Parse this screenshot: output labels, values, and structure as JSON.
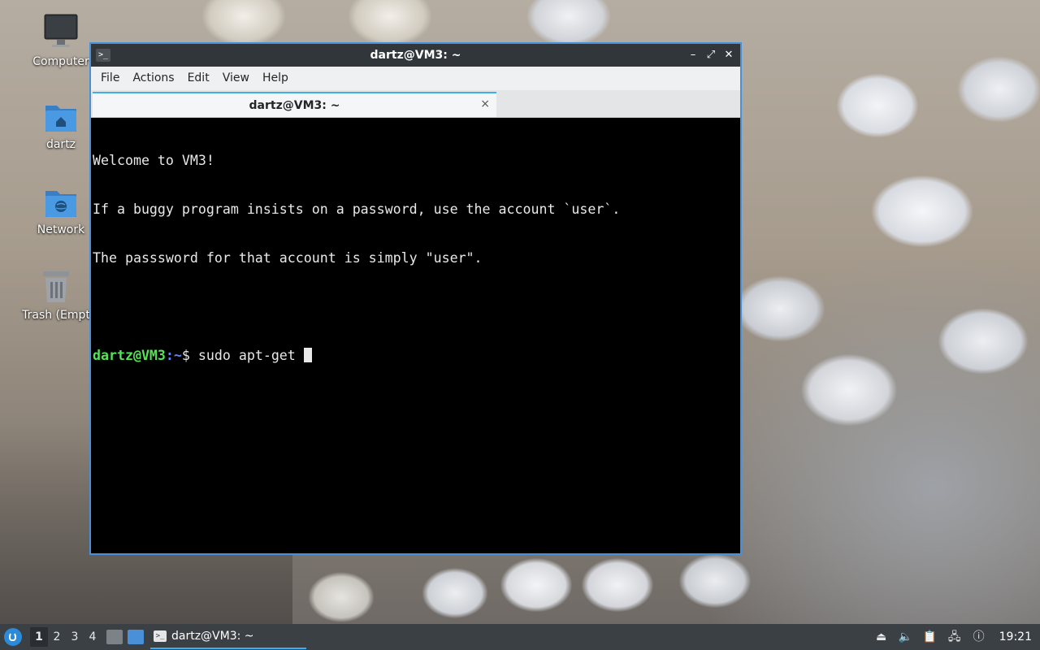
{
  "desktop": {
    "icons": [
      {
        "label": "Computer",
        "icon": "monitor-icon"
      },
      {
        "label": "dartz",
        "icon": "home-folder-icon"
      },
      {
        "label": "Network",
        "icon": "network-folder-icon"
      },
      {
        "label": "Trash (Empt",
        "icon": "trash-icon"
      }
    ]
  },
  "window": {
    "title": "dartz@VM3: ~",
    "app_icon": ">_",
    "controls": {
      "minimize": "–",
      "maximize": "⤢",
      "close": "✕"
    },
    "menu": [
      "File",
      "Actions",
      "Edit",
      "View",
      "Help"
    ],
    "tab": {
      "label": "dartz@VM3: ~",
      "close": "×"
    },
    "terminal": {
      "lines": [
        "Welcome to VM3!",
        "If a buggy program insists on a password, use the account `user`.",
        "The passsword for that account is simply \"user\"."
      ],
      "prompt_user": "dartz@VM3",
      "prompt_sep": ":",
      "prompt_path": "~",
      "prompt_symbol": "$ ",
      "command": "sudo apt-get "
    }
  },
  "taskbar": {
    "workspaces": [
      "1",
      "2",
      "3",
      "4"
    ],
    "active_workspace": "1",
    "task_label": "dartz@VM3: ~",
    "clock": "19:21"
  },
  "colors": {
    "accent": "#3daee9",
    "window_border": "#4a90d9",
    "prompt_user": "#54e354",
    "prompt_path": "#5a86ff",
    "taskbar": "#3b4045"
  }
}
